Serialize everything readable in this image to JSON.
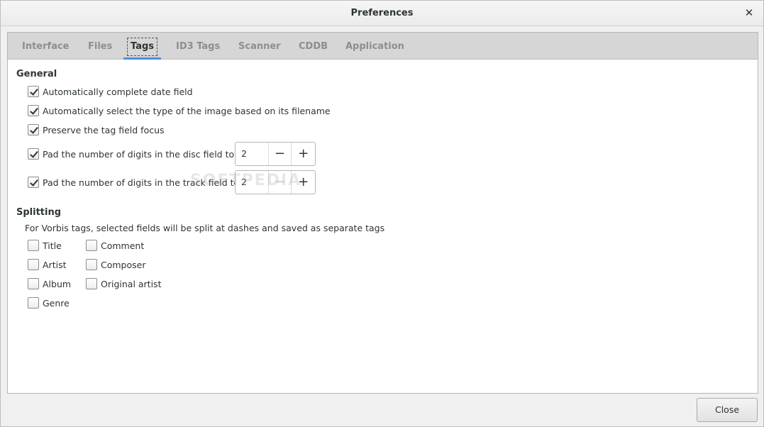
{
  "window": {
    "title": "Preferences",
    "close_icon": "close-icon"
  },
  "tabs": [
    {
      "label": "Interface",
      "active": false
    },
    {
      "label": "Files",
      "active": false
    },
    {
      "label": "Tags",
      "active": true
    },
    {
      "label": "ID3 Tags",
      "active": false
    },
    {
      "label": "Scanner",
      "active": false
    },
    {
      "label": "CDDB",
      "active": false
    },
    {
      "label": "Application",
      "active": false
    }
  ],
  "general": {
    "title": "General",
    "options": [
      {
        "label": "Automatically complete date field",
        "checked": true
      },
      {
        "label": "Automatically select the type of the image based on its filename",
        "checked": true
      },
      {
        "label": "Preserve the tag field focus",
        "checked": true
      }
    ],
    "disc_pad": {
      "label": "Pad the number of digits in the disc field to:",
      "checked": true,
      "value": "2"
    },
    "track_pad": {
      "label": "Pad the number of digits in the track field to:",
      "checked": true,
      "value": "2"
    }
  },
  "splitting": {
    "title": "Splitting",
    "description": "For Vorbis tags, selected fields will be split at dashes and saved as separate tags",
    "left_fields": [
      {
        "label": "Title",
        "checked": false
      },
      {
        "label": "Artist",
        "checked": false
      },
      {
        "label": "Album",
        "checked": false
      },
      {
        "label": "Genre",
        "checked": false
      }
    ],
    "right_fields": [
      {
        "label": "Comment",
        "checked": false
      },
      {
        "label": "Composer",
        "checked": false
      },
      {
        "label": "Original artist",
        "checked": false
      }
    ]
  },
  "footer": {
    "close_label": "Close"
  },
  "watermark": "SOFTPEDIA",
  "colors": {
    "accent": "#4a90d9",
    "tab_inactive": "#8a8f91",
    "text": "#2e3436"
  }
}
